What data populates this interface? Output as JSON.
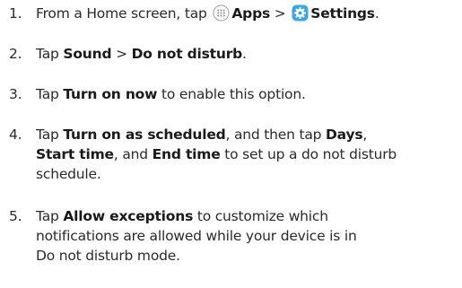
{
  "steps": [
    {
      "number": "1.",
      "prefix": "From a Home screen, tap ",
      "apps_icon": "apps-grid-icon",
      "apps_label": "Apps",
      "separator": " > ",
      "settings_icon": "settings-gear-icon",
      "settings_label": "Settings",
      "suffix": "."
    },
    {
      "number": "2.",
      "prefix": "Tap ",
      "b1": "Sound",
      "separator": " > ",
      "b2": "Do not disturb",
      "suffix": "."
    },
    {
      "number": "3.",
      "prefix": "Tap ",
      "b1": "Turn on now",
      "suffix": " to enable this option."
    },
    {
      "number": "4.",
      "prefix": "Tap ",
      "b1": "Turn on as scheduled",
      "mid1": ", and then tap ",
      "b2": "Days",
      "mid2": ",",
      "b3": "Start time",
      "mid3": ", and ",
      "b4": "End time",
      "mid4": " to set up a do not disturb",
      "line3": "schedule."
    },
    {
      "number": "5.",
      "prefix": "Tap ",
      "b1": "Allow exceptions",
      "mid1": " to customize which",
      "line2": "notifications are allowed while your device is in",
      "line3": "Do not disturb mode."
    }
  ],
  "colors": {
    "text": "#2a2a2a",
    "settings_icon_bg": "#3aa7e0",
    "apps_icon_ring": "#9a9a9a"
  }
}
